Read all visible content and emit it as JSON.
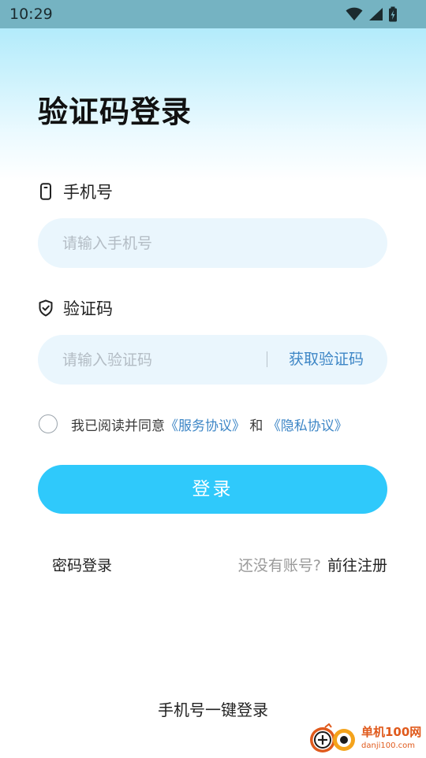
{
  "status_bar": {
    "time": "10:29",
    "icons": [
      "wifi-icon",
      "signal-icon",
      "battery-charging-icon"
    ]
  },
  "title": "验证码登录",
  "phone_field": {
    "label": "手机号",
    "icon": "phone-icon",
    "placeholder": "请输入手机号",
    "value": ""
  },
  "code_field": {
    "label": "验证码",
    "icon": "shield-check-icon",
    "placeholder": "请输入验证码",
    "value": "",
    "get_code_label": "获取验证码"
  },
  "agreement": {
    "checked": false,
    "prefix": "我已阅读并同意",
    "service_link": "《服务协议》",
    "conjunction": "和",
    "privacy_link": "《隐私协议》"
  },
  "login_button": "登录",
  "password_login": "密码登录",
  "register": {
    "hint": "还没有账号?",
    "link": "前往注册"
  },
  "one_key_login": "手机号一键登录",
  "watermark": {
    "name": "单机100网",
    "domain": "danji100.com"
  },
  "colors": {
    "accent": "#2fc9fb",
    "link": "#3d86c6",
    "input_bg": "#eaf6fd",
    "status_bar": "#75b3c2",
    "watermark": "#e05a1c"
  }
}
